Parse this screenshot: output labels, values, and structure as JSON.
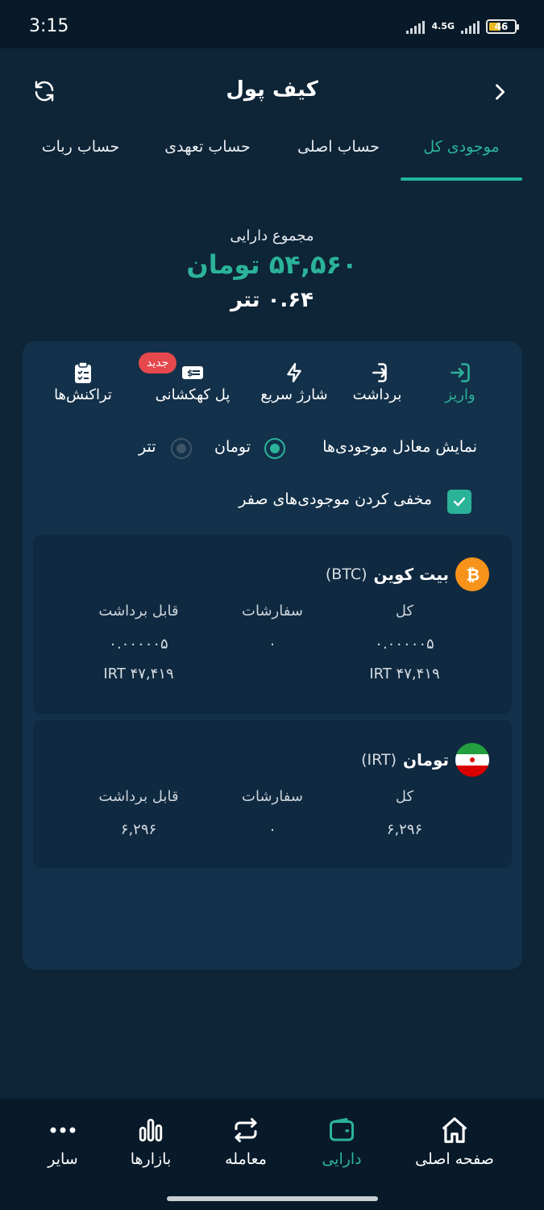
{
  "status_bar": {
    "time": "3:15",
    "network": "4.5G",
    "battery": "46"
  },
  "header": {
    "title": "کیف پول",
    "refresh_icon": "refresh-icon",
    "back_icon": "chevron-right-icon"
  },
  "tabs": [
    {
      "label": "موجودی کل",
      "active": true
    },
    {
      "label": "حساب اصلی",
      "active": false
    },
    {
      "label": "حساب تعهدی",
      "active": false
    },
    {
      "label": "حساب ربات",
      "active": false
    }
  ],
  "summary": {
    "label": "مجموع دارایی",
    "toman": "۵۴,۵۶۰ تومان",
    "tether": "۰.۶۴ تتر"
  },
  "actions": [
    {
      "label": "واریز",
      "icon": "deposit-icon"
    },
    {
      "label": "برداشت",
      "icon": "withdraw-icon"
    },
    {
      "label": "شارژ سریع",
      "icon": "flash-icon"
    },
    {
      "label": "پل کهکشانی",
      "icon": "bridge-ticket-icon",
      "badge": "جدید"
    },
    {
      "label": "تراکنش‌ها",
      "icon": "transactions-clipboard-icon"
    }
  ],
  "display_options": {
    "label": "نمایش معادل موجودی‌ها",
    "option_toman": "تومان",
    "option_tether": "تتر",
    "selected": "تومان"
  },
  "hide_zero": {
    "label": "مخفی کردن موجودی‌های صفر",
    "checked": true
  },
  "assets": [
    {
      "name": "بیت کوین",
      "code": "(BTC)",
      "icon": "bitcoin-icon",
      "col_total": "کل",
      "col_orders": "سفارشات",
      "col_available": "قابل برداشت",
      "total": "۰.۰۰۰۰۰۵",
      "orders": "۰",
      "available": "۰.۰۰۰۰۰۵",
      "total_irt": "۴۷,۴۱۹ IRT",
      "available_irt": "۴۷,۴۱۹ IRT"
    },
    {
      "name": "تومان",
      "code": "(IRT)",
      "icon": "iran-flag-icon",
      "col_total": "کل",
      "col_orders": "سفارشات",
      "col_available": "قابل برداشت",
      "total": "۶,۲۹۶",
      "orders": "۰",
      "available": "۶,۲۹۶"
    }
  ],
  "bottom_nav": [
    {
      "label": "صفحه اصلی",
      "icon": "home-icon",
      "active": false
    },
    {
      "label": "دارایی",
      "icon": "wallet-icon",
      "active": true
    },
    {
      "label": "معامله",
      "icon": "swap-icon",
      "active": false
    },
    {
      "label": "بازارها",
      "icon": "bar-chart-icon",
      "active": false
    },
    {
      "label": "سایر",
      "icon": "more-icon",
      "active": false
    }
  ],
  "colors": {
    "background": "#0e2437",
    "panel": "#13314a",
    "accent": "#2bb39a",
    "badge": "#e5484d",
    "bitcoin": "#f7931a"
  }
}
